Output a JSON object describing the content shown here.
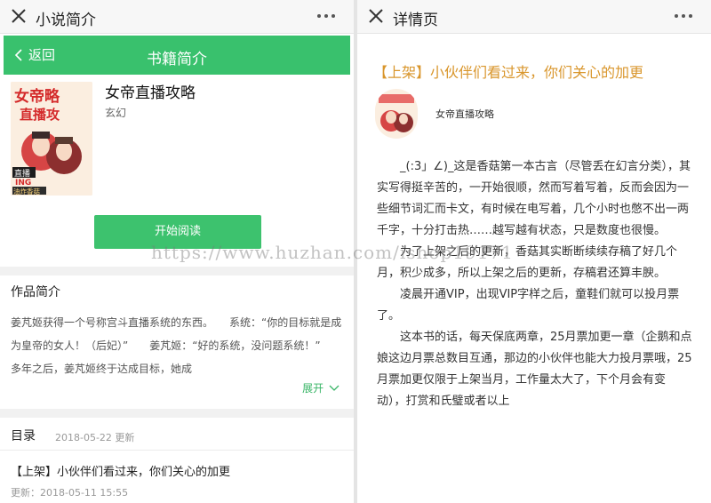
{
  "left": {
    "window_title": "小说简介",
    "nav": {
      "back_label": "返回",
      "title": "书籍简介"
    },
    "book": {
      "name": "女帝直播攻略",
      "category": "玄幻"
    },
    "cover_text": {
      "line1": "女帝略",
      "line2": "直播攻",
      "badge1": "直播",
      "badge2": "ING",
      "badge3": "油炸香菇"
    },
    "read_button": "开始阅读",
    "intro_heading": "作品简介",
    "intro_text": "姜芃姬获得一个号称宫斗直播系统的东西。　　系统：“你的目标就是成为皇帝的女人！（后妃）”　　姜芃姬：“好的系统，没问题系统！”　　多年之后，姜芃姬终于达成目标，她成",
    "expand_label": "展开",
    "toc": {
      "label": "目录",
      "date": "2018-05-22 更新"
    },
    "latest_chapter": {
      "title": "【上架】小伙伴们看过来，你们关心的加更",
      "update": "更新：2018-05-11 15:55"
    }
  },
  "right": {
    "window_title": "详情页",
    "chapter_title": "【上架】小伙伴们看过来，你们关心的加更",
    "book_name": "女帝直播攻略",
    "paragraphs": [
      "_(:3」∠)_这是香菇第一本古言（尽管丢在幻言分类），其实写得挺辛苦的，一开始很顺，然而写着写着，反而会因为一些细节词汇而卡文，有时候在电写着，几个小时也憋不出一两千字，十分打击热……越写越有状态，只是数度也很慢。",
      "为了上架之后的更新，香菇其实断断续续存稿了好几个月，积少成多，所以上架之后的更新，存稿君还算丰腴。",
      "凌晨开通VIP，出现VIP字样之后，童鞋们就可以投月票了。",
      "这本书的话，每天保底两章，25月票加更一章（企鹅和点娘这边月票总数目互通，那边的小伙伴也能大力投月票哦，25月票加更仅限于上架当月，工作量太大了，下个月会有变动），打赏和氏璧或者以上"
    ]
  },
  "watermark": "https://www.huzhan.com/ishop19171"
}
